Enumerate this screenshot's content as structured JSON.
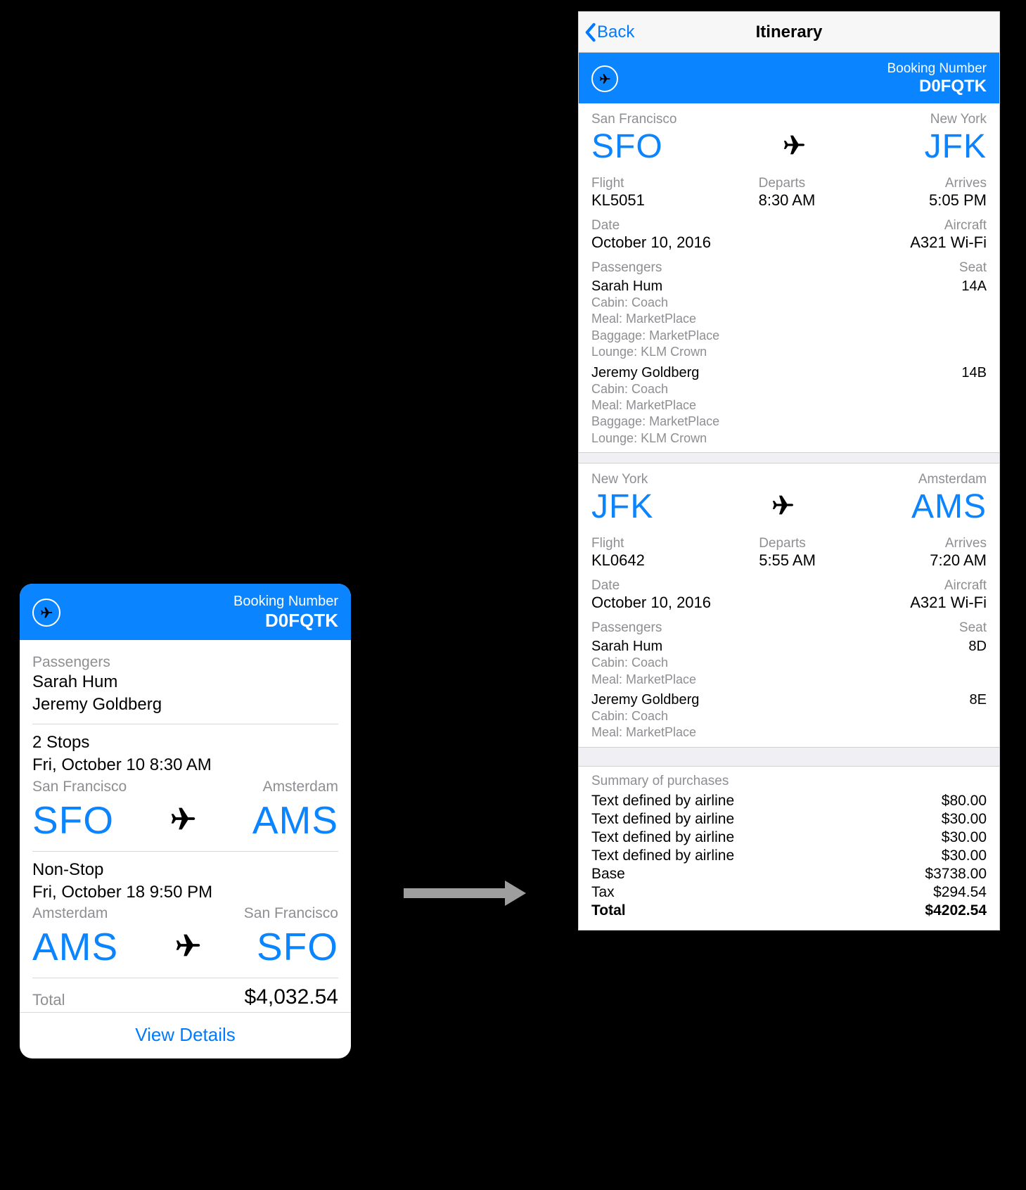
{
  "card": {
    "booking_label": "Booking Number",
    "booking_number": "D0FQTK",
    "passengers_label": "Passengers",
    "passengers": [
      "Sarah Hum",
      "Jeremy Goldberg"
    ],
    "segments": [
      {
        "stops": "2 Stops",
        "datetime": "Fri, October 10 8:30 AM",
        "from_city": "San Francisco",
        "to_city": "Amsterdam",
        "from_code": "SFO",
        "to_code": "AMS"
      },
      {
        "stops": "Non-Stop",
        "datetime": "Fri, October 18 9:50 PM",
        "from_city": "Amsterdam",
        "to_city": "San Francisco",
        "from_code": "AMS",
        "to_code": "SFO"
      }
    ],
    "total_label": "Total",
    "total_value": "$4,032.54",
    "view_details": "View Details"
  },
  "itin": {
    "back_label": "Back",
    "title": "Itinerary",
    "booking_label": "Booking Number",
    "booking_number": "D0FQTK",
    "segments": [
      {
        "from_city": "San Francisco",
        "to_city": "New York",
        "from_code": "SFO",
        "to_code": "JFK",
        "flight_label": "Flight",
        "flight": "KL5051",
        "departs_label": "Departs",
        "departs": "8:30 AM",
        "arrives_label": "Arrives",
        "arrives": "5:05 PM",
        "date_label": "Date",
        "date": "October 10, 2016",
        "aircraft_label": "Aircraft",
        "aircraft": "A321 Wi-Fi",
        "pax_label": "Passengers",
        "seat_label": "Seat",
        "pax": [
          {
            "name": "Sarah Hum",
            "seat": "14A",
            "details": [
              "Cabin: Coach",
              "Meal: MarketPlace",
              "Baggage: MarketPlace",
              "Lounge: KLM Crown"
            ]
          },
          {
            "name": "Jeremy Goldberg",
            "seat": "14B",
            "details": [
              "Cabin: Coach",
              "Meal: MarketPlace",
              "Baggage: MarketPlace",
              "Lounge: KLM Crown"
            ]
          }
        ]
      },
      {
        "from_city": "New York",
        "to_city": "Amsterdam",
        "from_code": "JFK",
        "to_code": "AMS",
        "flight_label": "Flight",
        "flight": "KL0642",
        "departs_label": "Departs",
        "departs": "5:55 AM",
        "arrives_label": "Arrives",
        "arrives": "7:20 AM",
        "date_label": "Date",
        "date": "October 10, 2016",
        "aircraft_label": "Aircraft",
        "aircraft": "A321 Wi-Fi",
        "pax_label": "Passengers",
        "seat_label": "Seat",
        "pax": [
          {
            "name": "Sarah Hum",
            "seat": "8D",
            "details": [
              "Cabin: Coach",
              "Meal: MarketPlace"
            ]
          },
          {
            "name": "Jeremy Goldberg",
            "seat": "8E",
            "details": [
              "Cabin: Coach",
              "Meal: MarketPlace"
            ]
          }
        ]
      }
    ],
    "purchases": {
      "heading": "Summary of purchases",
      "lines": [
        {
          "label": "Text defined by airline",
          "value": "$80.00"
        },
        {
          "label": "Text defined by airline",
          "value": "$30.00"
        },
        {
          "label": "Text defined by airline",
          "value": "$30.00"
        },
        {
          "label": "Text defined by airline",
          "value": "$30.00"
        },
        {
          "label": "Base",
          "value": "$3738.00"
        },
        {
          "label": "Tax",
          "value": "$294.54"
        }
      ],
      "total_label": "Total",
      "total_value": "$4202.54"
    }
  }
}
